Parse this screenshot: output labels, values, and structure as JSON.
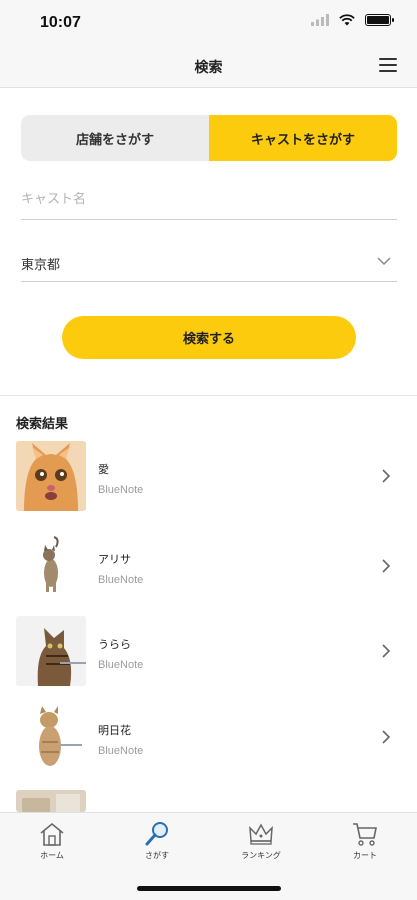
{
  "status_bar": {
    "time": "10:07"
  },
  "nav": {
    "title": "検索"
  },
  "segment": {
    "store_label": "店舗をさがす",
    "cast_label": "キャストをさがす",
    "selected": "cast"
  },
  "search_form": {
    "cast_name_placeholder": "キャスト名",
    "cast_name_value": "",
    "prefecture_value": "東京都",
    "submit_label": "検索する"
  },
  "results": {
    "title": "検索結果",
    "items": [
      {
        "name": "愛",
        "store": "BlueNote"
      },
      {
        "name": "アリサ",
        "store": "BlueNote"
      },
      {
        "name": "うらら",
        "store": "BlueNote"
      },
      {
        "name": "明日花",
        "store": "BlueNote"
      }
    ]
  },
  "tab_bar": {
    "tabs": [
      {
        "label": "ホーム",
        "icon": "home-icon"
      },
      {
        "label": "さがす",
        "icon": "search-icon"
      },
      {
        "label": "ランキング",
        "icon": "crown-icon"
      },
      {
        "label": "カート",
        "icon": "cart-icon"
      }
    ]
  },
  "colors": {
    "accent": "#fdcb0d",
    "segment_inactive": "#ececec",
    "muted_text": "#9c9c9c"
  }
}
